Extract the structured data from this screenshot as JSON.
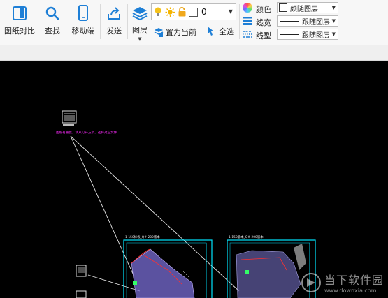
{
  "toolbar": {
    "compare_label": "图纸对比",
    "find_label": "查找",
    "mobile_label": "移动端",
    "send_label": "发送",
    "layer_label": "图层",
    "set_current_label": "置为当前",
    "select_all_label": "全选",
    "layer_value": "0",
    "color_label": "颜色",
    "linewidth_label": "线宽",
    "linetype_label": "线型",
    "color_value": "颜随图层",
    "linewidth_value": "跟随图层",
    "linetype_value": "跟随图层",
    "accent": "#1e7fd6"
  },
  "drawing": {
    "annotation_text": "图纸有重复，请从打开方案，选择对应文件",
    "sheet_left_title": "1-150标板_Q#-200版本",
    "sheet_right_title": "1-150版本_Q#-200版本",
    "canvas_bg": "#000000",
    "frame_color": "#00e5ff"
  },
  "watermark": {
    "text": "当下软件园",
    "url": "www.downxia.com"
  }
}
